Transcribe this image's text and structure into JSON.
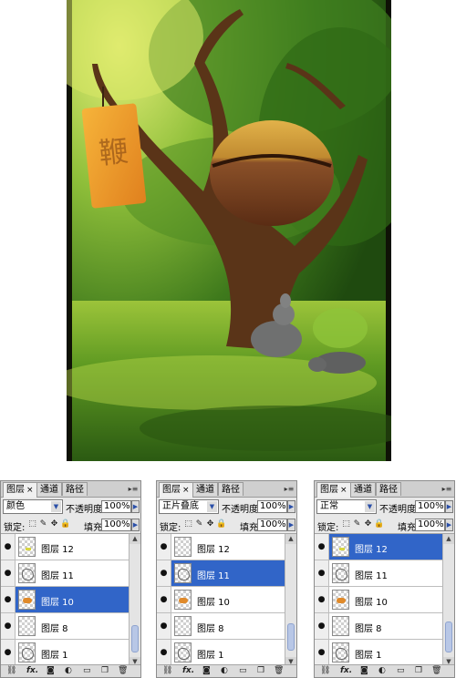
{
  "artwork": {
    "name": "forest-painting",
    "sign_glyph": "鞭"
  },
  "panels": [
    {
      "tabs": [
        {
          "label": "图层",
          "close": "×"
        },
        {
          "label": "通道"
        },
        {
          "label": "路径"
        }
      ],
      "menu_icon": "panel-menu-icon",
      "blend_mode": "颜色",
      "opacity_label": "不透明度:",
      "opacity": "100%",
      "lock_label": "锁定:",
      "fill_label": "填充:",
      "fill": "100%",
      "layers": [
        {
          "name": "图层 12",
          "visible": true,
          "selected": false,
          "thumb": "yellow"
        },
        {
          "name": "图层 11",
          "visible": true,
          "selected": false,
          "thumb": "sketch"
        },
        {
          "name": "图层 10",
          "visible": true,
          "selected": true,
          "thumb": "orange"
        },
        {
          "name": "图层 8",
          "visible": true,
          "selected": false,
          "thumb": "blank"
        },
        {
          "name": "图层 1",
          "visible": true,
          "selected": false,
          "thumb": "sketch"
        }
      ],
      "bottom_icons": [
        "link-icon",
        "fx-icon",
        "mask-icon",
        "adjustment-icon",
        "group-icon",
        "new-layer-icon",
        "trash-icon"
      ],
      "fx_label": "fx."
    },
    {
      "tabs": [
        {
          "label": "图层",
          "close": "×"
        },
        {
          "label": "通道"
        },
        {
          "label": "路径"
        }
      ],
      "menu_icon": "panel-menu-icon",
      "blend_mode": "正片叠底",
      "opacity_label": "不透明度:",
      "opacity": "100%",
      "lock_label": "锁定:",
      "fill_label": "填充:",
      "fill": "100%",
      "layers": [
        {
          "name": "图层 12",
          "visible": true,
          "selected": false,
          "thumb": "blank"
        },
        {
          "name": "图层 11",
          "visible": true,
          "selected": true,
          "thumb": "sketch"
        },
        {
          "name": "图层 10",
          "visible": true,
          "selected": false,
          "thumb": "orange"
        },
        {
          "name": "图层 8",
          "visible": true,
          "selected": false,
          "thumb": "blank"
        },
        {
          "name": "图层 1",
          "visible": true,
          "selected": false,
          "thumb": "sketch"
        }
      ],
      "bottom_icons": [
        "link-icon",
        "fx-icon",
        "mask-icon",
        "adjustment-icon",
        "group-icon",
        "new-layer-icon",
        "trash-icon"
      ],
      "fx_label": "fx."
    },
    {
      "tabs": [
        {
          "label": "图层",
          "close": "×"
        },
        {
          "label": "通道"
        },
        {
          "label": "路径"
        }
      ],
      "menu_icon": "panel-menu-icon",
      "blend_mode": "正常",
      "opacity_label": "不透明度:",
      "opacity": "100%",
      "lock_label": "锁定:",
      "fill_label": "填充:",
      "fill": "100%",
      "layers": [
        {
          "name": "图层 12",
          "visible": true,
          "selected": true,
          "thumb": "yellow"
        },
        {
          "name": "图层 11",
          "visible": true,
          "selected": false,
          "thumb": "sketch"
        },
        {
          "name": "图层 10",
          "visible": true,
          "selected": false,
          "thumb": "orange"
        },
        {
          "name": "图层 8",
          "visible": true,
          "selected": false,
          "thumb": "blank"
        },
        {
          "name": "图层 1",
          "visible": true,
          "selected": false,
          "thumb": "sketch"
        }
      ],
      "bottom_icons": [
        "link-icon",
        "fx-icon",
        "mask-icon",
        "adjustment-icon",
        "group-icon",
        "new-layer-icon",
        "trash-icon"
      ],
      "fx_label": "fx."
    }
  ],
  "colors": {
    "selection": "#3165c8",
    "panel_bg": "#e8e8e8",
    "foliage": "#4f8a1e",
    "trunk": "#5a3418",
    "sign": "#f0a02a"
  }
}
